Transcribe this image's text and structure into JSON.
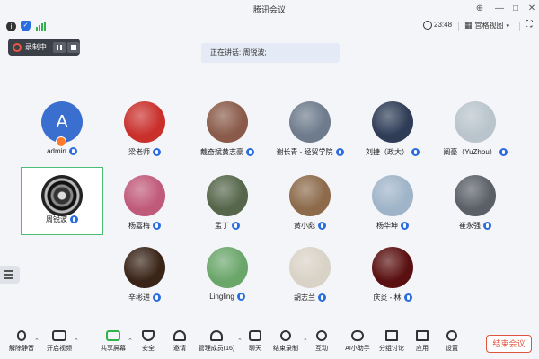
{
  "window": {
    "title": "腾讯会议"
  },
  "infobar": {
    "time": "23:48",
    "view_label": "宫格视图"
  },
  "recording": {
    "label": "录制中"
  },
  "speaking": {
    "text": "正在讲话: 周锐波;"
  },
  "participants": [
    {
      "name": "admin",
      "avatar": "initial-A",
      "initial": "A",
      "host": true,
      "color": "#3b6fcf"
    },
    {
      "name": "梁老师",
      "avatar": "photo-red-flowers",
      "color": "#c9302c"
    },
    {
      "name": "戴奋斌黄志豪",
      "avatar": "photo-people",
      "color": "#8a5b4a"
    },
    {
      "name": "谢长青 - 经贸学院",
      "avatar": "photo-vase",
      "color": "#6e7b8c"
    },
    {
      "name": "刘捷（政大）",
      "avatar": "photo-man-suit",
      "color": "#2e3c56"
    },
    {
      "name": "阐豪（YuZhou）",
      "avatar": "photo-man-shirt",
      "color": "#b9c4cc"
    },
    {
      "name": "周锐波",
      "avatar": "camera-lens",
      "highlighted": true,
      "color": "#222222"
    },
    {
      "name": "杨嘉梅",
      "avatar": "photo-pink-flowers",
      "color": "#c05a7a"
    },
    {
      "name": "孟丁",
      "avatar": "photo-waterfall",
      "color": "#55664a"
    },
    {
      "name": "黄小彪",
      "avatar": "photo-man-outdoor",
      "color": "#8c6a4a"
    },
    {
      "name": "杨华坤",
      "avatar": "photo-mountain-lake",
      "color": "#9fb4c8"
    },
    {
      "name": "崔永强",
      "avatar": "photo-car-interior",
      "color": "#5b6068"
    },
    {
      "name": "辛彬进",
      "avatar": "photo-dark-light",
      "color": "#3a2418"
    },
    {
      "name": "Lingling",
      "avatar": "photo-plant",
      "color": "#6aa66a"
    },
    {
      "name": "胡志兰",
      "avatar": "photo-cat",
      "color": "#d9d2c6"
    },
    {
      "name": "庆炎 - 林",
      "avatar": "photo-dark-red",
      "color": "#5a1010"
    }
  ],
  "toolbar": {
    "unmute": "解除静音",
    "video": "开启视频",
    "share": "共享屏幕",
    "security": "安全",
    "invite": "邀请",
    "members": "管理成员(16)",
    "chat": "聊天",
    "end_recording": "结束录制",
    "interact": "互动",
    "ai_assistant": "AI小助手",
    "breakout": "分组讨论",
    "apps": "应用",
    "settings": "设置",
    "end_meeting": "结束会议"
  },
  "colors": {
    "accent_blue": "#2a6de0",
    "end_red": "#e0533c",
    "highlight_green": "#4cbd72",
    "signal_green": "#2fb34a"
  }
}
